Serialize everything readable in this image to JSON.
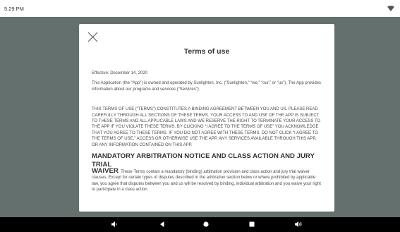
{
  "status_bar": {
    "time": "5:29 PM",
    "wifi_icon": "wifi-icon"
  },
  "modal": {
    "close_icon": "close-icon",
    "title": "Terms of use",
    "effective": "Effective: December 14, 2020",
    "intro": "This Application (the “App”) is owned and operated by Sunlighten, Inc. (“Sunlighten,” “we,” “our,” or “us”). The App provides information about our programs and services (“Services”).",
    "legal": "THIS TERMS OF USE (“TERMS”) CONSTITUTES A BINDING AGREEMENT BETWEEN YOU AND US. PLEASE READ CAREFULLY THROUGH ALL SECTIONS OF THESE TERMS. YOUR ACCESS TO AND USE OF THE APP IS SUBJECT TO THESE TERMS AND ALL APPLICABLE LAWS AND WE RESERVE THE RIGHT TO TERMINATE YOUR ACCESS TO THE APP IF YOU VIOLATE THESE TERMS. BY CLICKING “I AGREE TO THE TERMS OF USE” YOU ACKNOWLEDGE THAT YOU AGREE TO THESE TERMS. IF YOU DO NOT AGREE WITH THESE TERMS, DO NOT CLICK “I AGREE TO THE TERMS OF USE,” ACCESS OR OTHERWISE USE THE APP, ANY SERVICES AVAILABLE THROUGH THIS APP, OR ANY INFORMATION CONTAINED ON THIS APP.",
    "arbitration_heading": "MANDATORY ARBITRATION NOTICE AND CLASS ACTION AND JURY TRIAL",
    "arbitration_heading_cont": "WAIVER",
    "arbitration_text": ". These Terms contain a mandatory (binding) arbitration provision and class action and jury trial waiver clauses. Except for certain types of disputes described in the arbitration section below or where prohibited by applicable law, you agree that disputes between you and us will be resolved by binding, individual arbitration and you waive your right to participate in a class action"
  },
  "nav_bar": {
    "buttons": [
      {
        "name": "volume-down-icon"
      },
      {
        "name": "back-icon"
      },
      {
        "name": "home-icon"
      },
      {
        "name": "recents-icon"
      },
      {
        "name": "volume-up-icon"
      }
    ]
  }
}
